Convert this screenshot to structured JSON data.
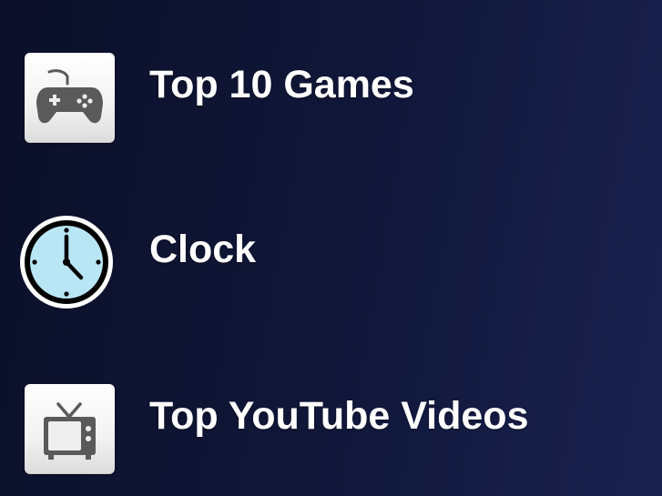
{
  "menu": {
    "items": [
      {
        "label": "Top 10 Games",
        "icon": "gamepad-icon"
      },
      {
        "label": "Clock",
        "icon": "clock-icon"
      },
      {
        "label": "Top YouTube Videos",
        "icon": "tv-icon"
      }
    ]
  },
  "colors": {
    "background_dark": "#0b1028",
    "background_light": "#1b2250",
    "label_text": "#ffffff",
    "icon_glyph": "#5a5a5a",
    "clock_face": "#b9e6f5"
  }
}
